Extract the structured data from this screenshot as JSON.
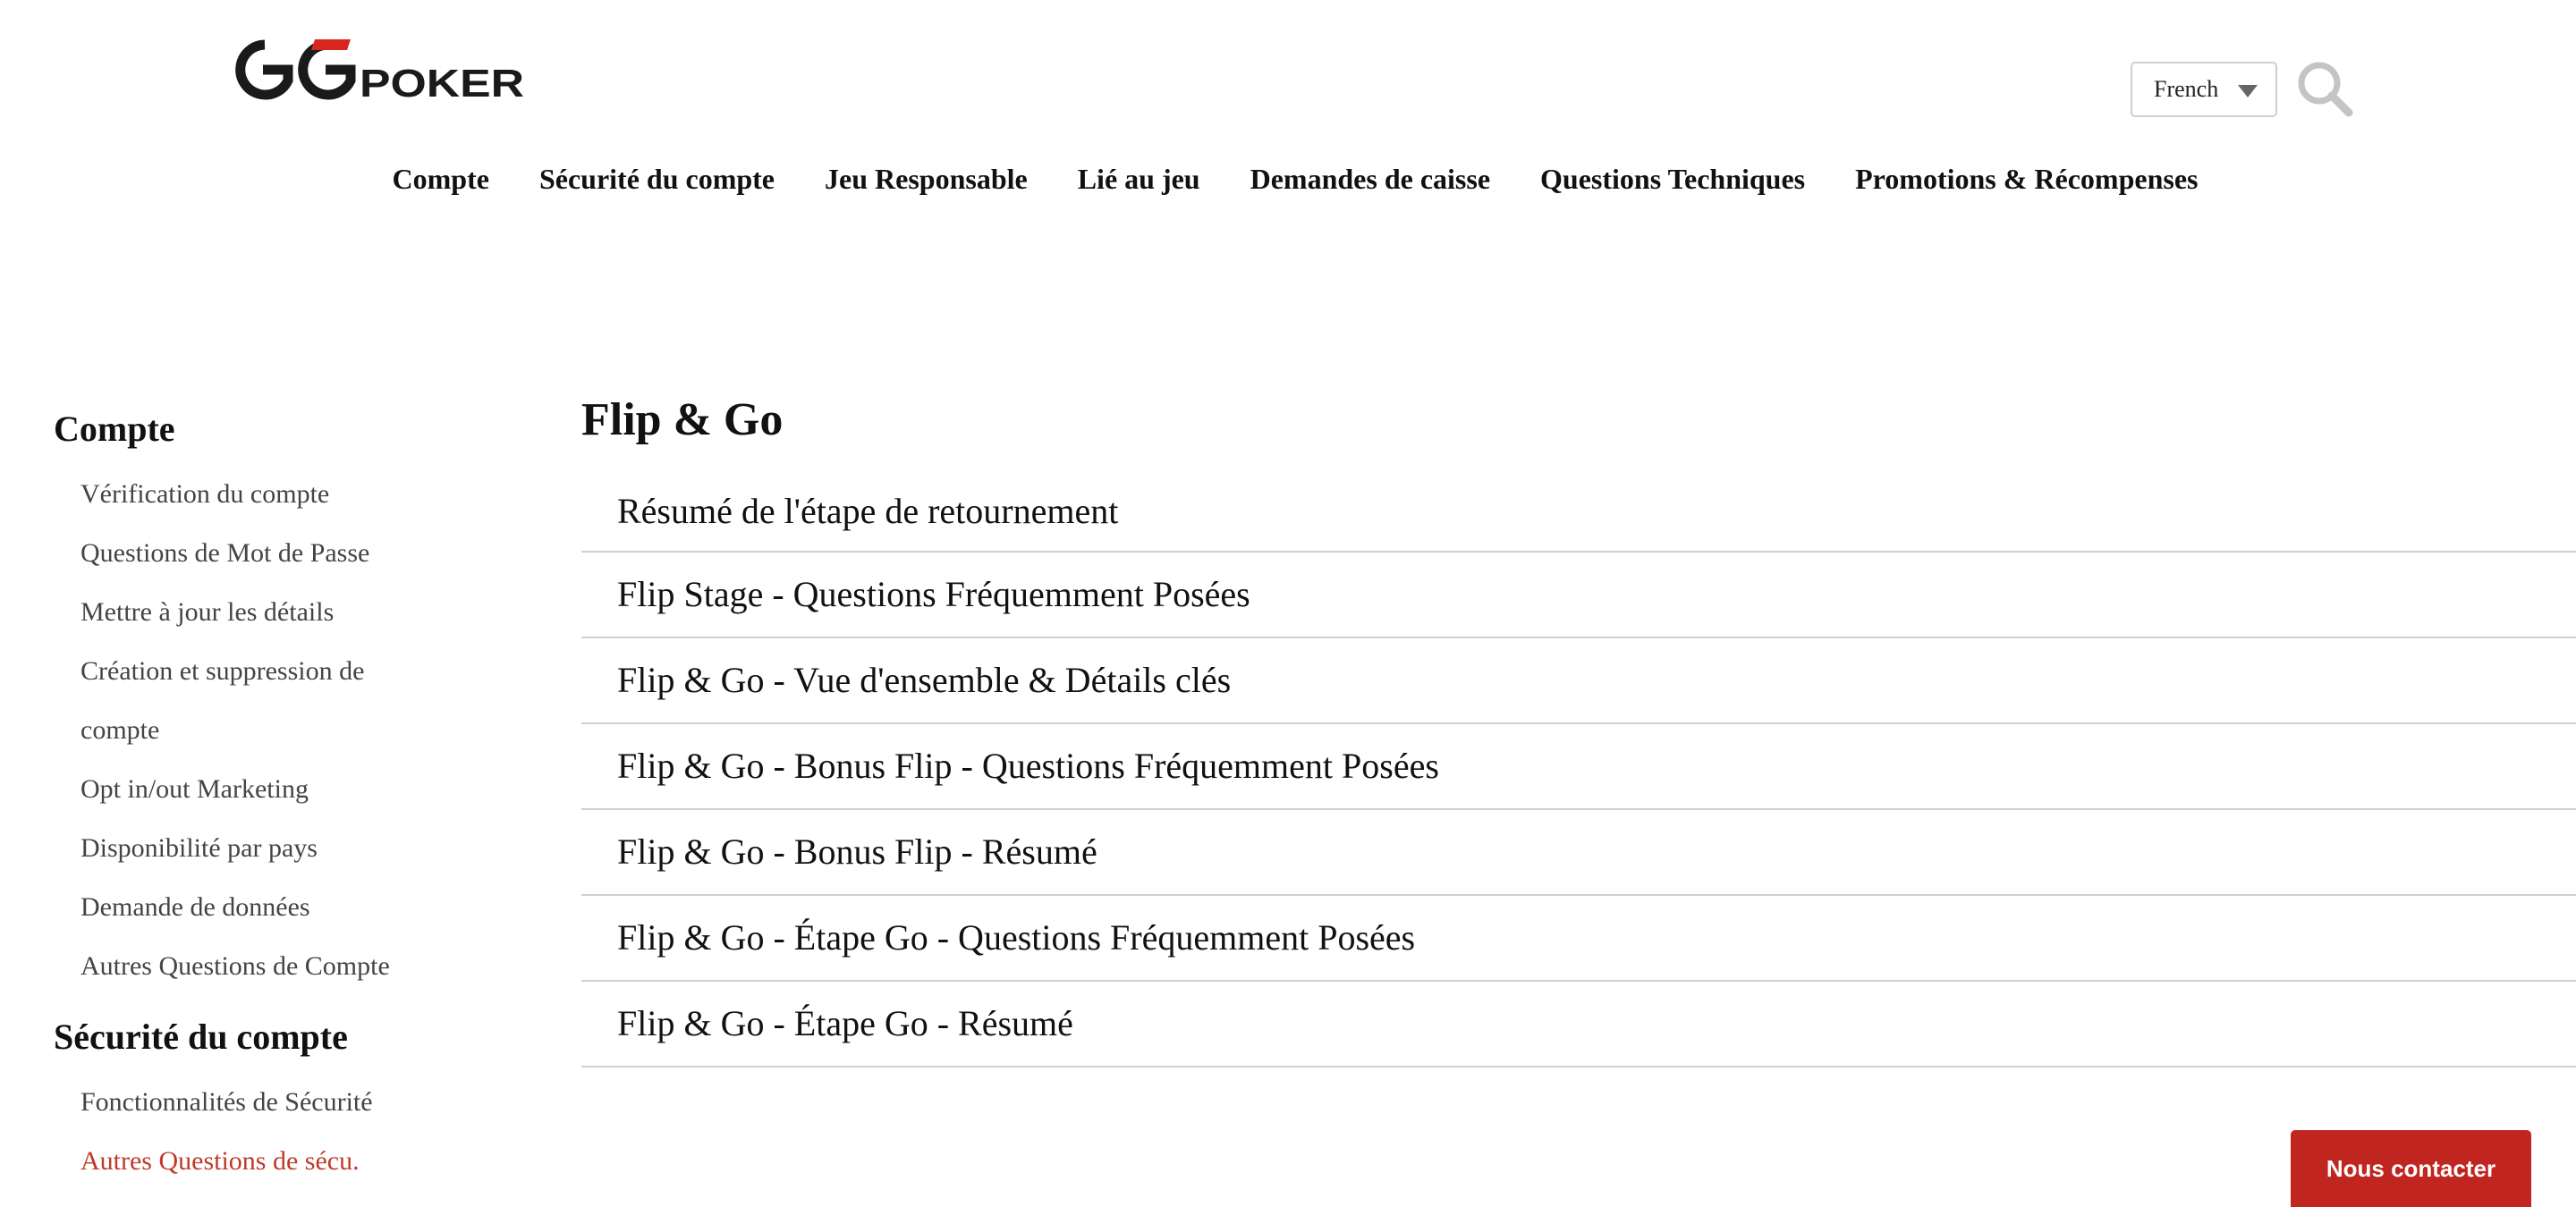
{
  "header": {
    "logo_text": "GGPOKER",
    "language": {
      "selected": "French"
    },
    "icons": {
      "search": "search-icon",
      "dropdown": "chevron-down-icon"
    },
    "nav": [
      {
        "label": "Compte"
      },
      {
        "label": "Sécurité du compte"
      },
      {
        "label": "Jeu Responsable"
      },
      {
        "label": "Lié au jeu"
      },
      {
        "label": "Demandes de caisse"
      },
      {
        "label": "Questions Techniques"
      },
      {
        "label": "Promotions & Récompenses"
      }
    ]
  },
  "sidebar": {
    "sections": [
      {
        "title": "Compte",
        "items": [
          {
            "label": "Vérification du compte"
          },
          {
            "label": "Questions de Mot de Passe"
          },
          {
            "label": "Mettre à jour les détails"
          },
          {
            "label": "Création et suppression de"
          },
          {
            "label": "compte"
          },
          {
            "label": "Opt in/out Marketing"
          },
          {
            "label": "Disponibilité par pays"
          },
          {
            "label": "Demande de données"
          },
          {
            "label": "Autres Questions de Compte"
          }
        ]
      },
      {
        "title": "Sécurité du compte",
        "items": [
          {
            "label": "Fonctionnalités de Sécurité"
          },
          {
            "label": "Autres Questions de sécu."
          }
        ]
      }
    ]
  },
  "main": {
    "title": "Flip & Go",
    "articles": [
      {
        "label": "Résumé de l'étape de retournement"
      },
      {
        "label": "Flip Stage - Questions Fréquemment Posées"
      },
      {
        "label": "Flip & Go - Vue d'ensemble & Détails clés"
      },
      {
        "label": "Flip & Go - Bonus Flip - Questions Fréquemment Posées"
      },
      {
        "label": "Flip & Go - Bonus Flip - Résumé"
      },
      {
        "label": "Flip & Go - Étape Go - Questions Fréquemment Posées"
      },
      {
        "label": "Flip & Go - Étape Go - Résumé"
      }
    ]
  },
  "contact": {
    "label": "Nous contacter"
  },
  "colors": {
    "brand_red": "#c0261f",
    "active_link": "#c0392b",
    "divider": "#cfcfcf"
  }
}
